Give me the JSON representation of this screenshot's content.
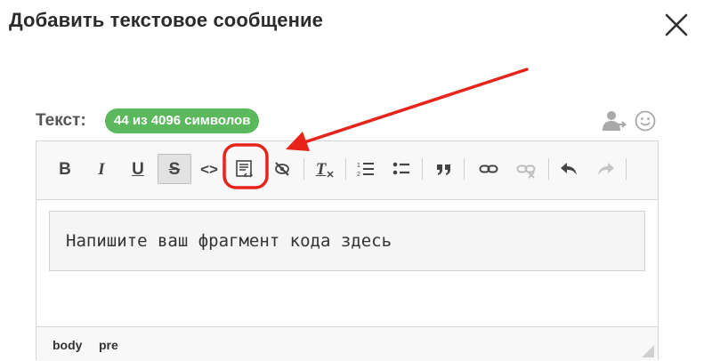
{
  "dialog": {
    "title": "Добавить текстовое сообщение"
  },
  "text_field": {
    "label": "Текст:",
    "char_count": "44 из 4096 символов",
    "char_count_color": "#5cb85c",
    "right_icons": [
      "user-share-icon",
      "smiley-icon"
    ]
  },
  "toolbar": {
    "bold_label": "B",
    "italic_label": "I",
    "underline_label": "U",
    "strike_label": "S",
    "code_label": "<>",
    "clear_format_label": "T",
    "buttons": [
      "bold-icon",
      "italic-icon",
      "underline-icon",
      "strikethrough-icon",
      "inline-code-icon",
      "code-block-icon",
      "hide-icon",
      "clear-format-icon",
      "numbered-list-icon",
      "bulleted-list-icon",
      "quote-icon",
      "link-icon",
      "unlink-icon",
      "undo-icon",
      "redo-icon"
    ],
    "highlighted_button": "code-block-icon",
    "highlight_color": "#e8231a"
  },
  "editor": {
    "code_placeholder": "Напишите ваш фрагмент кода здесь"
  },
  "statusbar": {
    "path": [
      "body",
      "pre"
    ]
  }
}
